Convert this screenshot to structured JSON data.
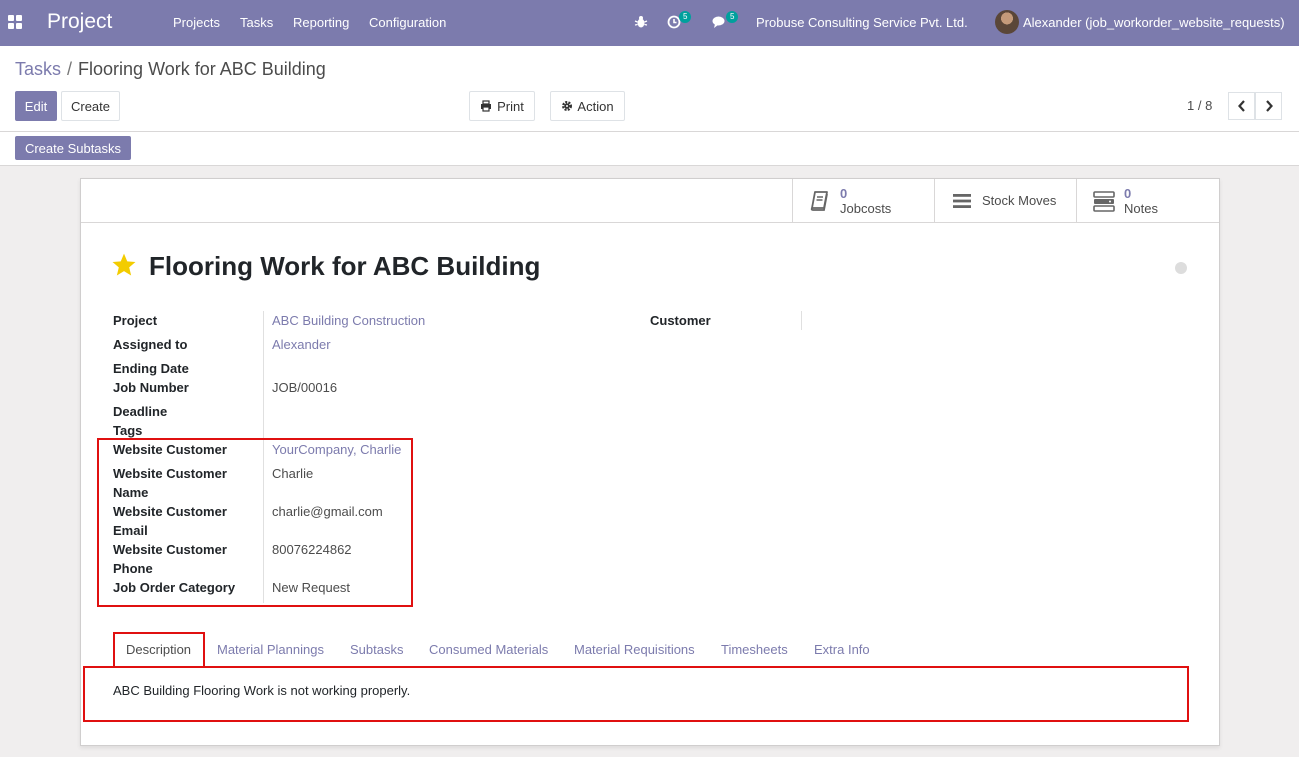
{
  "navbar": {
    "app_name": "Project",
    "menu": [
      "Projects",
      "Tasks",
      "Reporting",
      "Configuration"
    ],
    "activity_count": "5",
    "message_count": "5",
    "company": "Probuse Consulting Service Pvt. Ltd.",
    "user": "Alexander (job_workorder_website_requests)",
    "accent_color": "#7c7bad"
  },
  "breadcrumb": {
    "parent": "Tasks",
    "separator": "/",
    "current": "Flooring Work for ABC Building"
  },
  "toolbar": {
    "edit": "Edit",
    "create": "Create",
    "print": "Print",
    "action": "Action",
    "create_subtasks": "Create Subtasks"
  },
  "pager": {
    "value": "1 / 8"
  },
  "smart_buttons": {
    "jobcosts": {
      "count": "0",
      "label": "Jobcosts"
    },
    "stock_moves": {
      "label": "Stock Moves"
    },
    "notes": {
      "count": "0",
      "label": "Notes"
    }
  },
  "record": {
    "title": "Flooring Work for ABC Building",
    "starred": true
  },
  "fields": {
    "project": {
      "label": "Project",
      "value": "ABC Building Construction"
    },
    "customer": {
      "label": "Customer",
      "value": ""
    },
    "assigned_to": {
      "label": "Assigned to",
      "value": "Alexander"
    },
    "ending_date": {
      "label": "Ending Date",
      "value": ""
    },
    "job_number": {
      "label": "Job Number",
      "value": "JOB/00016"
    },
    "deadline": {
      "label": "Deadline",
      "value": ""
    },
    "tags": {
      "label": "Tags",
      "value": ""
    },
    "website_customer": {
      "label": "Website Customer",
      "value": "YourCompany, Charlie"
    },
    "website_customer_name": {
      "label1": "Website Customer",
      "label2": "Name",
      "value": "Charlie"
    },
    "website_customer_email": {
      "label1": "Website Customer",
      "label2": "Email",
      "value": "charlie@gmail.com"
    },
    "website_customer_phone": {
      "label1": "Website Customer",
      "label2": "Phone",
      "value": "80076224862"
    },
    "job_order_category": {
      "label": "Job Order Category",
      "value": "New Request"
    }
  },
  "tabs": [
    "Description",
    "Material Plannings",
    "Subtasks",
    "Consumed Materials",
    "Material Requisitions",
    "Timesheets",
    "Extra Info"
  ],
  "description": "ABC Building Flooring Work is not working properly."
}
